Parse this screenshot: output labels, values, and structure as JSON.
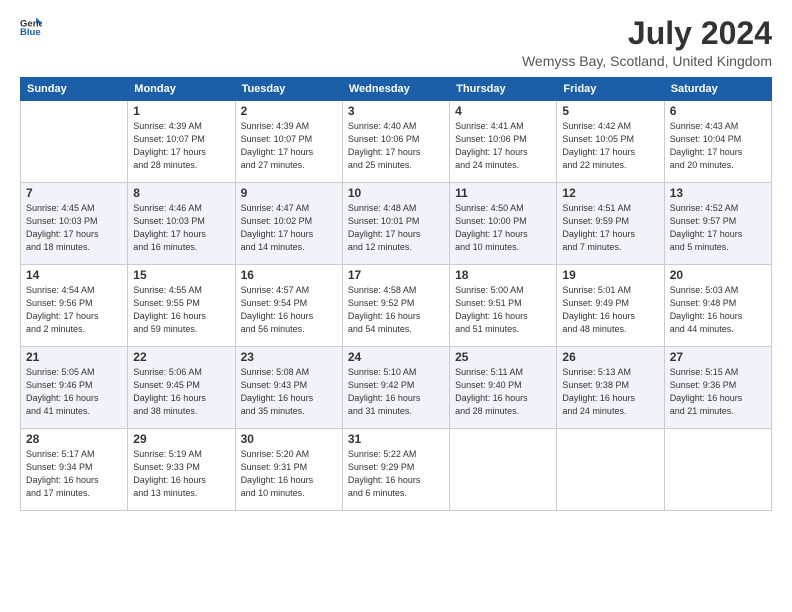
{
  "header": {
    "logo_general": "General",
    "logo_blue": "Blue",
    "title": "July 2024",
    "location": "Wemyss Bay, Scotland, United Kingdom"
  },
  "days_of_week": [
    "Sunday",
    "Monday",
    "Tuesday",
    "Wednesday",
    "Thursday",
    "Friday",
    "Saturday"
  ],
  "weeks": [
    [
      {
        "day": "",
        "info": ""
      },
      {
        "day": "1",
        "info": "Sunrise: 4:39 AM\nSunset: 10:07 PM\nDaylight: 17 hours\nand 28 minutes."
      },
      {
        "day": "2",
        "info": "Sunrise: 4:39 AM\nSunset: 10:07 PM\nDaylight: 17 hours\nand 27 minutes."
      },
      {
        "day": "3",
        "info": "Sunrise: 4:40 AM\nSunset: 10:06 PM\nDaylight: 17 hours\nand 25 minutes."
      },
      {
        "day": "4",
        "info": "Sunrise: 4:41 AM\nSunset: 10:06 PM\nDaylight: 17 hours\nand 24 minutes."
      },
      {
        "day": "5",
        "info": "Sunrise: 4:42 AM\nSunset: 10:05 PM\nDaylight: 17 hours\nand 22 minutes."
      },
      {
        "day": "6",
        "info": "Sunrise: 4:43 AM\nSunset: 10:04 PM\nDaylight: 17 hours\nand 20 minutes."
      }
    ],
    [
      {
        "day": "7",
        "info": "Sunrise: 4:45 AM\nSunset: 10:03 PM\nDaylight: 17 hours\nand 18 minutes."
      },
      {
        "day": "8",
        "info": "Sunrise: 4:46 AM\nSunset: 10:03 PM\nDaylight: 17 hours\nand 16 minutes."
      },
      {
        "day": "9",
        "info": "Sunrise: 4:47 AM\nSunset: 10:02 PM\nDaylight: 17 hours\nand 14 minutes."
      },
      {
        "day": "10",
        "info": "Sunrise: 4:48 AM\nSunset: 10:01 PM\nDaylight: 17 hours\nand 12 minutes."
      },
      {
        "day": "11",
        "info": "Sunrise: 4:50 AM\nSunset: 10:00 PM\nDaylight: 17 hours\nand 10 minutes."
      },
      {
        "day": "12",
        "info": "Sunrise: 4:51 AM\nSunset: 9:59 PM\nDaylight: 17 hours\nand 7 minutes."
      },
      {
        "day": "13",
        "info": "Sunrise: 4:52 AM\nSunset: 9:57 PM\nDaylight: 17 hours\nand 5 minutes."
      }
    ],
    [
      {
        "day": "14",
        "info": "Sunrise: 4:54 AM\nSunset: 9:56 PM\nDaylight: 17 hours\nand 2 minutes."
      },
      {
        "day": "15",
        "info": "Sunrise: 4:55 AM\nSunset: 9:55 PM\nDaylight: 16 hours\nand 59 minutes."
      },
      {
        "day": "16",
        "info": "Sunrise: 4:57 AM\nSunset: 9:54 PM\nDaylight: 16 hours\nand 56 minutes."
      },
      {
        "day": "17",
        "info": "Sunrise: 4:58 AM\nSunset: 9:52 PM\nDaylight: 16 hours\nand 54 minutes."
      },
      {
        "day": "18",
        "info": "Sunrise: 5:00 AM\nSunset: 9:51 PM\nDaylight: 16 hours\nand 51 minutes."
      },
      {
        "day": "19",
        "info": "Sunrise: 5:01 AM\nSunset: 9:49 PM\nDaylight: 16 hours\nand 48 minutes."
      },
      {
        "day": "20",
        "info": "Sunrise: 5:03 AM\nSunset: 9:48 PM\nDaylight: 16 hours\nand 44 minutes."
      }
    ],
    [
      {
        "day": "21",
        "info": "Sunrise: 5:05 AM\nSunset: 9:46 PM\nDaylight: 16 hours\nand 41 minutes."
      },
      {
        "day": "22",
        "info": "Sunrise: 5:06 AM\nSunset: 9:45 PM\nDaylight: 16 hours\nand 38 minutes."
      },
      {
        "day": "23",
        "info": "Sunrise: 5:08 AM\nSunset: 9:43 PM\nDaylight: 16 hours\nand 35 minutes."
      },
      {
        "day": "24",
        "info": "Sunrise: 5:10 AM\nSunset: 9:42 PM\nDaylight: 16 hours\nand 31 minutes."
      },
      {
        "day": "25",
        "info": "Sunrise: 5:11 AM\nSunset: 9:40 PM\nDaylight: 16 hours\nand 28 minutes."
      },
      {
        "day": "26",
        "info": "Sunrise: 5:13 AM\nSunset: 9:38 PM\nDaylight: 16 hours\nand 24 minutes."
      },
      {
        "day": "27",
        "info": "Sunrise: 5:15 AM\nSunset: 9:36 PM\nDaylight: 16 hours\nand 21 minutes."
      }
    ],
    [
      {
        "day": "28",
        "info": "Sunrise: 5:17 AM\nSunset: 9:34 PM\nDaylight: 16 hours\nand 17 minutes."
      },
      {
        "day": "29",
        "info": "Sunrise: 5:19 AM\nSunset: 9:33 PM\nDaylight: 16 hours\nand 13 minutes."
      },
      {
        "day": "30",
        "info": "Sunrise: 5:20 AM\nSunset: 9:31 PM\nDaylight: 16 hours\nand 10 minutes."
      },
      {
        "day": "31",
        "info": "Sunrise: 5:22 AM\nSunset: 9:29 PM\nDaylight: 16 hours\nand 6 minutes."
      },
      {
        "day": "",
        "info": ""
      },
      {
        "day": "",
        "info": ""
      },
      {
        "day": "",
        "info": ""
      }
    ]
  ]
}
